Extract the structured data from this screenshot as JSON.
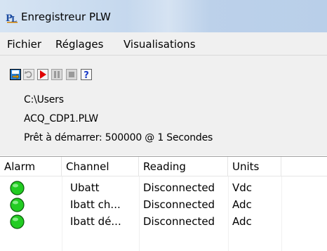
{
  "window": {
    "title": "Enregistreur PLW",
    "icon": "picolog-icon"
  },
  "menu": {
    "items": [
      "Fichier",
      "Réglages",
      "Visualisations"
    ]
  },
  "toolbar": {
    "buttons": [
      {
        "name": "save-settings",
        "icon": "save-icon"
      },
      {
        "name": "undo",
        "icon": "undo-icon"
      },
      {
        "name": "record",
        "icon": "play-icon"
      },
      {
        "name": "pause",
        "icon": "pause-icon"
      },
      {
        "name": "stop",
        "icon": "stop-icon"
      },
      {
        "name": "help",
        "icon": "help-icon"
      }
    ],
    "help_glyph": "?"
  },
  "info": {
    "folder": "C:\\Users",
    "file": "ACQ_CDP1.PLW",
    "status": "Prêt à démarrer: 500000 @ 1 Secondes"
  },
  "table": {
    "columns": [
      "Alarm",
      "Channel",
      "Reading",
      "Units"
    ],
    "rows": [
      {
        "alarm": "green",
        "channel": "Ubatt",
        "reading": "Disconnected",
        "units": "Vdc"
      },
      {
        "alarm": "green",
        "channel": "Ibatt ch...",
        "reading": "Disconnected",
        "units": "Adc"
      },
      {
        "alarm": "green",
        "channel": "Ibatt dé...",
        "reading": "Disconnected",
        "units": "Adc"
      }
    ]
  },
  "colors": {
    "alarm_ok": "#22cc22",
    "record": "#e00000",
    "help": "#1a3cc8"
  }
}
